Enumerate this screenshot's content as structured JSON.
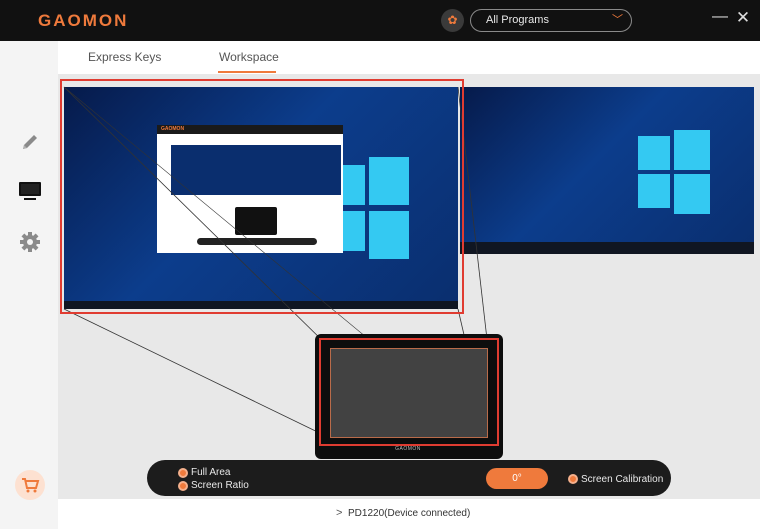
{
  "app": {
    "logo": "GAOMON"
  },
  "header": {
    "program_select": {
      "value": "All Programs"
    },
    "icons": [
      "program-icon",
      "minimize-icon",
      "close-icon"
    ]
  },
  "tabs": [
    {
      "label": "Express Keys",
      "active": false
    },
    {
      "label": "Workspace",
      "active": true
    }
  ],
  "sidebar": {
    "items": [
      {
        "icon": "pen-icon"
      },
      {
        "icon": "monitor-icon",
        "active": true
      },
      {
        "icon": "gear-icon"
      }
    ],
    "cart_icon": "cart-icon"
  },
  "workspace": {
    "tablet_brand": "GAOMON",
    "controls": {
      "full_area_label": "Full Area",
      "screen_ratio_label": "Screen Ratio",
      "rotation_value": "0°",
      "calibration_label": "Screen Calibration"
    }
  },
  "footer": {
    "device_status": "PD1220(Device connected)"
  },
  "colors": {
    "accent": "#ef7a3c",
    "mapping_outline": "#e03c31",
    "titlebar": "#111111"
  }
}
